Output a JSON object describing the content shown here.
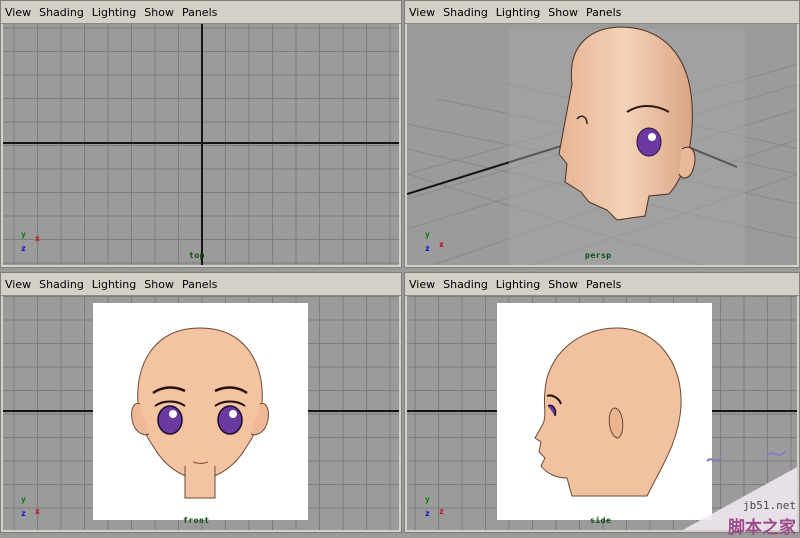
{
  "menu": [
    "View",
    "Shading",
    "Lighting",
    "Show",
    "Panels"
  ],
  "panels": {
    "top": {
      "camera_label": "top"
    },
    "persp": {
      "camera_label": "persp"
    },
    "front": {
      "camera_label": "front"
    },
    "side": {
      "camera_label": "side"
    }
  },
  "axes": {
    "top": [
      "y",
      "x",
      "z"
    ],
    "persp": [
      "y",
      "x",
      "z"
    ],
    "front": [
      "y",
      "x",
      "z"
    ],
    "side": [
      "y",
      "z",
      "z"
    ]
  },
  "watermark": {
    "site": "jb51.net",
    "brand": "脚本之家"
  },
  "colors": {
    "grid_bg": "#9b9b9b",
    "grid_line": "#7c7c7c",
    "axis_line": "#141414",
    "skin": "#f2c3a0",
    "eye": "#5a2a8a",
    "axis_x": "#d00000",
    "axis_y": "#008000",
    "axis_z": "#0000d0"
  },
  "icons": [
    "maya-axis-gizmo-icon",
    "anime-head-reference-image",
    "3d-head-model"
  ]
}
